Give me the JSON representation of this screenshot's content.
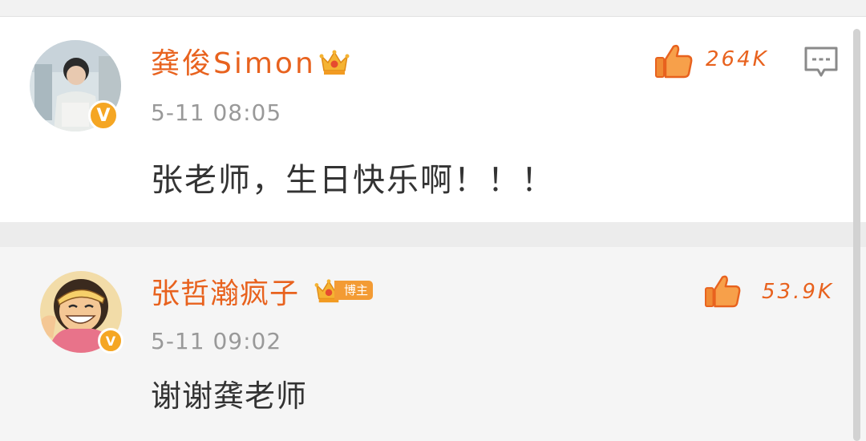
{
  "comments": [
    {
      "author": "龚俊Simon",
      "time": "5-11 08:05",
      "text": "张老师，生日快乐啊！！！",
      "likes": "264K",
      "verified_badge": "V",
      "icons": {
        "crown": "vip-crown-icon",
        "like": "thumbs-up-icon",
        "comment": "comment-bubble-icon"
      }
    },
    {
      "author": "张哲瀚疯子",
      "time": "5-11 09:02",
      "text": "谢谢龚老师",
      "likes": "53.9K",
      "verified_badge": "V",
      "author_tag": "博主",
      "icons": {
        "crown": "vip-crown-icon",
        "like": "thumbs-up-icon"
      }
    }
  ],
  "colors": {
    "accent": "#e8621e",
    "badge": "#f5a623",
    "timestamp": "#999999",
    "text": "#333333"
  }
}
